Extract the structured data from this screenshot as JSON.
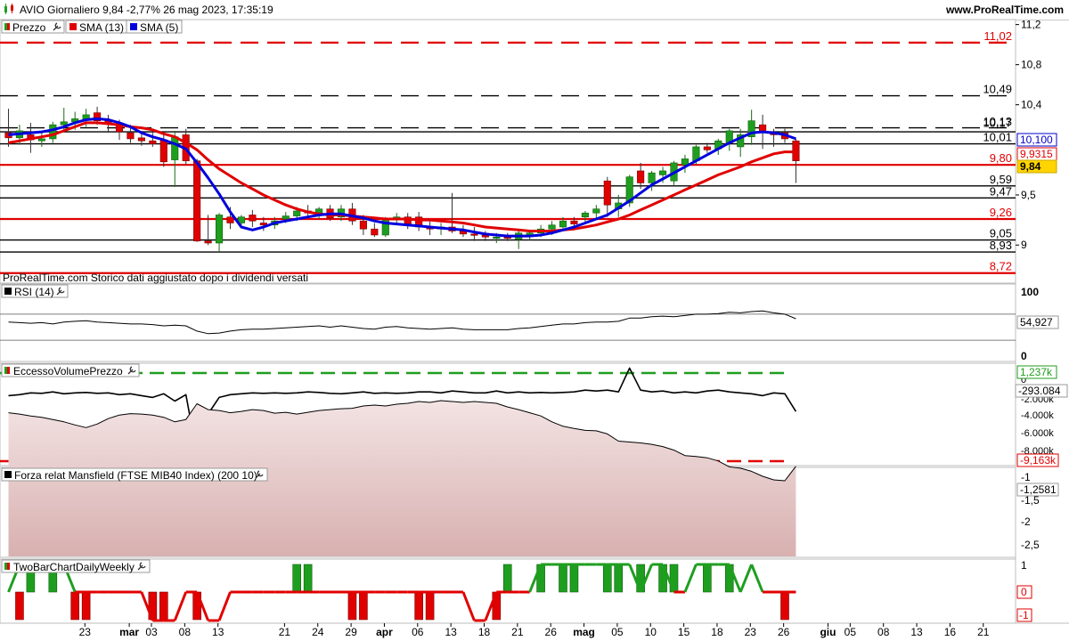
{
  "header": {
    "title": "AVIO Giornaliero 9,84 -2,77% 26 mag 2023, 17:35:19",
    "site": "www.ProRealTime.com"
  },
  "price_panel": {
    "legend": [
      "Prezzo",
      "SMA (13)",
      "SMA (5)"
    ],
    "footnote": "ProRealTime.com  Storico dati aggiustato dopo i dividendi versati",
    "axis_ticks": [
      "11,2",
      "10,8",
      "10,4",
      "9,5",
      "9"
    ],
    "levels": [
      {
        "label": "11,02",
        "value": 11.02,
        "color": "#e00000",
        "style": "dash"
      },
      {
        "label": "10,49",
        "value": 10.49,
        "color": "#000000",
        "style": "dash"
      },
      {
        "label": "10,17",
        "value": 10.17,
        "color": "#000000",
        "style": "dash"
      },
      {
        "label": "10,13",
        "value": 10.13,
        "color": "#000000",
        "style": "solid"
      },
      {
        "label": "10,01",
        "value": 10.01,
        "color": "#000000",
        "style": "solid"
      },
      {
        "label": "9,80",
        "value": 9.8,
        "color": "#e00000",
        "style": "solid"
      },
      {
        "label": "9,59",
        "value": 9.59,
        "color": "#000000",
        "style": "solid"
      },
      {
        "label": "9,47",
        "value": 9.47,
        "color": "#000000",
        "style": "solid"
      },
      {
        "label": "9,26",
        "value": 9.26,
        "color": "#e00000",
        "style": "solid"
      },
      {
        "label": "9,05",
        "value": 9.05,
        "color": "#000000",
        "style": "solid"
      },
      {
        "label": "8,93",
        "value": 8.93,
        "color": "#000000",
        "style": "solid"
      },
      {
        "label": "8,72",
        "value": 8.72,
        "color": "#e00000",
        "style": "solid"
      }
    ],
    "badges": [
      {
        "label": "10,100",
        "value": 10.1,
        "color": "#0000cc",
        "bg": "#ffffff"
      },
      {
        "label": "9,9315",
        "value": 9.9315,
        "color": "#e00000",
        "bg": "#ffffff"
      },
      {
        "label": "9,84",
        "value": 9.84,
        "color": "#000000",
        "bg": "#ffd400"
      }
    ]
  },
  "rsi_panel": {
    "legend": "RSI (14)",
    "axis_ticks": [
      "100",
      "0"
    ],
    "badge": "54,927"
  },
  "volume_panel": {
    "legend": "EccessoVolumePrezzo",
    "axis_ticks": [
      "0",
      "-2.000k",
      "-4.000k",
      "-6.000k",
      "-8.000k"
    ],
    "badges": [
      "1,237k",
      "-293.084",
      "-9,163k"
    ]
  },
  "mansfield_panel": {
    "legend": "Forza relat Mansfield (FTSE MIB40 Index) (200 10)",
    "axis_ticks": [
      "-1",
      "-1,5",
      "-2",
      "-2,5"
    ],
    "badge": "-1,2581"
  },
  "twobar_panel": {
    "legend": "TwoBarChartDailyWeekly",
    "axis_ticks": [
      "1",
      "0",
      "-1"
    ]
  },
  "x_axis": {
    "ticks": [
      {
        "i": 4,
        "label": "23"
      },
      {
        "i": 8,
        "label": "mar",
        "bold": true
      },
      {
        "i": 10,
        "label": "03"
      },
      {
        "i": 13,
        "label": "08"
      },
      {
        "i": 16,
        "label": "13"
      },
      {
        "i": 22,
        "label": "21"
      },
      {
        "i": 25,
        "label": "24"
      },
      {
        "i": 28,
        "label": "29"
      },
      {
        "i": 31,
        "label": "apr",
        "bold": true
      },
      {
        "i": 34,
        "label": "06"
      },
      {
        "i": 37,
        "label": "13"
      },
      {
        "i": 40,
        "label": "18"
      },
      {
        "i": 43,
        "label": "21"
      },
      {
        "i": 46,
        "label": "26"
      },
      {
        "i": 49,
        "label": "mag",
        "bold": true
      },
      {
        "i": 52,
        "label": "05"
      },
      {
        "i": 55,
        "label": "10"
      },
      {
        "i": 58,
        "label": "15"
      },
      {
        "i": 61,
        "label": "18"
      },
      {
        "i": 64,
        "label": "23"
      },
      {
        "i": 67,
        "label": "26"
      },
      {
        "i": 71,
        "label": "giu",
        "bold": true
      },
      {
        "i": 73,
        "label": "05"
      },
      {
        "i": 76,
        "label": "08"
      },
      {
        "i": 79,
        "label": "13"
      },
      {
        "i": 82,
        "label": "16"
      },
      {
        "i": 85,
        "label": "21"
      }
    ]
  },
  "colors": {
    "up": "#1e9e1e",
    "down": "#e00000",
    "sma13": "#e00000",
    "sma5": "#0000dd",
    "mansfield_fill": "#d8b0b0"
  },
  "chart_data": {
    "type": "candlestick",
    "ylim": [
      8.62,
      11.25
    ],
    "candles": [
      {
        "o": 10.12,
        "h": 10.36,
        "l": 9.98,
        "c": 10.07
      },
      {
        "o": 10.07,
        "h": 10.2,
        "l": 10.0,
        "c": 10.14
      },
      {
        "o": 10.1,
        "h": 10.22,
        "l": 9.92,
        "c": 10.05
      },
      {
        "o": 10.04,
        "h": 10.13,
        "l": 9.98,
        "c": 10.06
      },
      {
        "o": 10.06,
        "h": 10.23,
        "l": 10.02,
        "c": 10.2
      },
      {
        "o": 10.2,
        "h": 10.37,
        "l": 10.13,
        "c": 10.23
      },
      {
        "o": 10.23,
        "h": 10.33,
        "l": 10.15,
        "c": 10.26
      },
      {
        "o": 10.25,
        "h": 10.36,
        "l": 10.18,
        "c": 10.3
      },
      {
        "o": 10.32,
        "h": 10.38,
        "l": 10.2,
        "c": 10.24
      },
      {
        "o": 10.24,
        "h": 10.3,
        "l": 10.12,
        "c": 10.21
      },
      {
        "o": 10.2,
        "h": 10.25,
        "l": 10.05,
        "c": 10.13
      },
      {
        "o": 10.12,
        "h": 10.2,
        "l": 10.02,
        "c": 10.06
      },
      {
        "o": 10.07,
        "h": 10.14,
        "l": 9.99,
        "c": 10.04
      },
      {
        "o": 10.04,
        "h": 10.12,
        "l": 9.98,
        "c": 10.01
      },
      {
        "o": 10.05,
        "h": 10.1,
        "l": 9.78,
        "c": 9.83
      },
      {
        "o": 9.85,
        "h": 10.14,
        "l": 9.58,
        "c": 10.08
      },
      {
        "o": 10.1,
        "h": 10.16,
        "l": 9.8,
        "c": 9.84
      },
      {
        "o": 9.84,
        "h": 9.86,
        "l": 9.03,
        "c": 9.04
      },
      {
        "o": 9.04,
        "h": 9.3,
        "l": 9.0,
        "c": 9.02
      },
      {
        "o": 9.02,
        "h": 9.32,
        "l": 8.93,
        "c": 9.3
      },
      {
        "o": 9.28,
        "h": 9.38,
        "l": 9.16,
        "c": 9.22
      },
      {
        "o": 9.22,
        "h": 9.3,
        "l": 9.18,
        "c": 9.28
      },
      {
        "o": 9.3,
        "h": 9.35,
        "l": 9.18,
        "c": 9.24
      },
      {
        "o": 9.22,
        "h": 9.28,
        "l": 9.14,
        "c": 9.2
      },
      {
        "o": 9.2,
        "h": 9.28,
        "l": 9.16,
        "c": 9.24
      },
      {
        "o": 9.26,
        "h": 9.33,
        "l": 9.22,
        "c": 9.29
      },
      {
        "o": 9.29,
        "h": 9.38,
        "l": 9.24,
        "c": 9.34
      },
      {
        "o": 9.34,
        "h": 9.4,
        "l": 9.28,
        "c": 9.32
      },
      {
        "o": 9.32,
        "h": 9.38,
        "l": 9.26,
        "c": 9.36
      },
      {
        "o": 9.36,
        "h": 9.4,
        "l": 9.24,
        "c": 9.27
      },
      {
        "o": 9.28,
        "h": 9.4,
        "l": 9.24,
        "c": 9.36
      },
      {
        "o": 9.36,
        "h": 9.42,
        "l": 9.2,
        "c": 9.24
      },
      {
        "o": 9.24,
        "h": 9.3,
        "l": 9.1,
        "c": 9.16
      },
      {
        "o": 9.16,
        "h": 9.22,
        "l": 9.08,
        "c": 9.1
      },
      {
        "o": 9.1,
        "h": 9.28,
        "l": 9.08,
        "c": 9.26
      },
      {
        "o": 9.26,
        "h": 9.32,
        "l": 9.2,
        "c": 9.28
      },
      {
        "o": 9.28,
        "h": 9.32,
        "l": 9.16,
        "c": 9.2
      },
      {
        "o": 9.28,
        "h": 9.33,
        "l": 9.14,
        "c": 9.18
      },
      {
        "o": 9.18,
        "h": 9.24,
        "l": 9.1,
        "c": 9.16
      },
      {
        "o": 9.16,
        "h": 9.22,
        "l": 9.1,
        "c": 9.18
      },
      {
        "o": 9.18,
        "h": 9.52,
        "l": 9.12,
        "c": 9.14
      },
      {
        "o": 9.14,
        "h": 9.2,
        "l": 9.08,
        "c": 9.11
      },
      {
        "o": 9.11,
        "h": 9.18,
        "l": 9.04,
        "c": 9.1
      },
      {
        "o": 9.1,
        "h": 9.14,
        "l": 9.04,
        "c": 9.08
      },
      {
        "o": 9.07,
        "h": 9.12,
        "l": 9.02,
        "c": 9.08
      },
      {
        "o": 9.08,
        "h": 9.12,
        "l": 9.04,
        "c": 9.07
      },
      {
        "o": 9.06,
        "h": 9.14,
        "l": 8.96,
        "c": 9.12
      },
      {
        "o": 9.1,
        "h": 9.14,
        "l": 9.05,
        "c": 9.12
      },
      {
        "o": 9.12,
        "h": 9.2,
        "l": 9.08,
        "c": 9.16
      },
      {
        "o": 9.16,
        "h": 9.24,
        "l": 9.1,
        "c": 9.2
      },
      {
        "o": 9.18,
        "h": 9.28,
        "l": 9.14,
        "c": 9.24
      },
      {
        "o": 9.24,
        "h": 9.28,
        "l": 9.18,
        "c": 9.21
      },
      {
        "o": 9.28,
        "h": 9.34,
        "l": 9.22,
        "c": 9.32
      },
      {
        "o": 9.32,
        "h": 9.4,
        "l": 9.26,
        "c": 9.36
      },
      {
        "o": 9.64,
        "h": 9.68,
        "l": 9.28,
        "c": 9.4
      },
      {
        "o": 9.36,
        "h": 9.5,
        "l": 9.28,
        "c": 9.42
      },
      {
        "o": 9.42,
        "h": 9.7,
        "l": 9.38,
        "c": 9.68
      },
      {
        "o": 9.74,
        "h": 9.82,
        "l": 9.56,
        "c": 9.62
      },
      {
        "o": 9.62,
        "h": 9.74,
        "l": 9.54,
        "c": 9.72
      },
      {
        "o": 9.7,
        "h": 9.78,
        "l": 9.62,
        "c": 9.74
      },
      {
        "o": 9.64,
        "h": 9.84,
        "l": 9.6,
        "c": 9.82
      },
      {
        "o": 9.8,
        "h": 9.9,
        "l": 9.72,
        "c": 9.86
      },
      {
        "o": 9.84,
        "h": 10.0,
        "l": 9.8,
        "c": 9.98
      },
      {
        "o": 9.98,
        "h": 10.02,
        "l": 9.92,
        "c": 9.95
      },
      {
        "o": 9.96,
        "h": 10.06,
        "l": 9.9,
        "c": 10.04
      },
      {
        "o": 10.02,
        "h": 10.16,
        "l": 9.94,
        "c": 10.14
      },
      {
        "o": 9.98,
        "h": 10.16,
        "l": 9.88,
        "c": 10.1
      },
      {
        "o": 10.08,
        "h": 10.35,
        "l": 10.0,
        "c": 10.24
      },
      {
        "o": 10.2,
        "h": 10.3,
        "l": 9.96,
        "c": 10.12
      },
      {
        "o": 10.12,
        "h": 10.16,
        "l": 9.98,
        "c": 10.1
      },
      {
        "o": 10.12,
        "h": 10.16,
        "l": 10.02,
        "c": 10.06
      },
      {
        "o": 10.04,
        "h": 10.06,
        "l": 9.62,
        "c": 9.84
      }
    ],
    "sma13": [
      10.02,
      10.04,
      10.06,
      10.08,
      10.1,
      10.14,
      10.18,
      10.22,
      10.22,
      10.21,
      10.2,
      10.18,
      10.17,
      10.15,
      10.11,
      10.08,
      10.02,
      9.95,
      9.85,
      9.76,
      9.69,
      9.62,
      9.56,
      9.5,
      9.45,
      9.4,
      9.36,
      9.33,
      9.31,
      9.3,
      9.3,
      9.29,
      9.28,
      9.27,
      9.26,
      9.26,
      9.26,
      9.25,
      9.25,
      9.24,
      9.23,
      9.22,
      9.2,
      9.18,
      9.17,
      9.16,
      9.15,
      9.14,
      9.14,
      9.14,
      9.15,
      9.16,
      9.18,
      9.2,
      9.23,
      9.26,
      9.3,
      9.35,
      9.4,
      9.45,
      9.5,
      9.55,
      9.6,
      9.65,
      9.7,
      9.74,
      9.78,
      9.83,
      9.87,
      9.91,
      9.93,
      9.93
    ],
    "sma5": [
      10.1,
      10.11,
      10.12,
      10.13,
      10.15,
      10.18,
      10.22,
      10.25,
      10.26,
      10.25,
      10.22,
      10.18,
      10.12,
      10.08,
      10.05,
      10.01,
      9.96,
      9.82,
      9.67,
      9.51,
      9.33,
      9.18,
      9.15,
      9.18,
      9.22,
      9.24,
      9.26,
      9.28,
      9.3,
      9.31,
      9.31,
      9.29,
      9.27,
      9.24,
      9.22,
      9.21,
      9.2,
      9.19,
      9.18,
      9.17,
      9.16,
      9.15,
      9.13,
      9.11,
      9.1,
      9.09,
      9.09,
      9.09,
      9.1,
      9.12,
      9.15,
      9.18,
      9.22,
      9.26,
      9.3,
      9.37,
      9.44,
      9.52,
      9.6,
      9.66,
      9.72,
      9.78,
      9.84,
      9.9,
      9.96,
      10.02,
      10.07,
      10.12,
      10.13,
      10.12,
      10.1,
      10.06
    ],
    "rsi": [
      58,
      57,
      56,
      57,
      55,
      58,
      59,
      60,
      58,
      57,
      56,
      55,
      55,
      54,
      52,
      53,
      52,
      44,
      40,
      41,
      44,
      46,
      47,
      47,
      48,
      49,
      50,
      51,
      52,
      50,
      52,
      50,
      48,
      47,
      50,
      51,
      49,
      48,
      47,
      48,
      49,
      47,
      46,
      46,
      46,
      46,
      48,
      49,
      51,
      53,
      55,
      55,
      57,
      58,
      58,
      59,
      64,
      64,
      66,
      67,
      66,
      68,
      70,
      70,
      71,
      73,
      72,
      74,
      75,
      72,
      70,
      63
    ],
    "volume": [
      -120,
      -110,
      -90,
      -95,
      -80,
      -100,
      -90,
      -85,
      -95,
      -90,
      -110,
      -100,
      -120,
      -140,
      -100,
      -180,
      -110,
      -760,
      -320,
      -140,
      -110,
      -100,
      -90,
      -95,
      -90,
      -95,
      -90,
      -80,
      -85,
      -95,
      -100,
      -90,
      -80,
      -95,
      -90,
      -95,
      -90,
      -80,
      -80,
      -90,
      -70,
      -80,
      -90,
      -90,
      -70,
      -90,
      -80,
      -90,
      -85,
      -90,
      -85,
      -80,
      -60,
      -70,
      -60,
      -80,
      180,
      -60,
      -80,
      -70,
      -90,
      -80,
      -90,
      -70,
      -60,
      -80,
      -90,
      -100,
      -120,
      -90,
      -100,
      -293
    ],
    "mansfield": [
      -2.45,
      -2.42,
      -2.38,
      -2.35,
      -2.3,
      -2.25,
      -2.18,
      -2.12,
      -2.2,
      -2.32,
      -2.4,
      -2.43,
      -2.42,
      -2.4,
      -2.35,
      -2.25,
      -2.3,
      -2.65,
      -2.52,
      -2.5,
      -2.45,
      -2.48,
      -2.52,
      -2.5,
      -2.44,
      -2.46,
      -2.42,
      -2.46,
      -2.5,
      -2.52,
      -2.54,
      -2.55,
      -2.6,
      -2.62,
      -2.6,
      -2.64,
      -2.66,
      -2.7,
      -2.68,
      -2.72,
      -2.7,
      -2.68,
      -2.7,
      -2.68,
      -2.66,
      -2.58,
      -2.52,
      -2.45,
      -2.38,
      -2.25,
      -2.15,
      -2.1,
      -2.06,
      -2.05,
      -1.98,
      -1.82,
      -1.8,
      -1.78,
      -1.75,
      -1.7,
      -1.62,
      -1.5,
      -1.48,
      -1.45,
      -1.38,
      -1.25,
      -1.22,
      -1.15,
      -1.04,
      -0.96,
      -0.94,
      -1.26
    ],
    "twobar_bars": [
      0,
      -1,
      1,
      0,
      1,
      0,
      -1,
      -1,
      0,
      0,
      0,
      0,
      0,
      -1,
      -1,
      0,
      0,
      -1,
      0,
      0,
      0,
      0,
      0,
      0,
      0,
      0,
      1,
      1,
      0,
      0,
      0,
      -1,
      -1,
      0,
      0,
      0,
      0,
      -1,
      -1,
      0,
      0,
      0,
      0,
      0,
      -1,
      1,
      0,
      0,
      1,
      0,
      1,
      1,
      0,
      0,
      1,
      1,
      0,
      1,
      0,
      1,
      1,
      0,
      0,
      1,
      0,
      1,
      0,
      0,
      0,
      0,
      -1,
      0
    ],
    "twobar_line": [
      0,
      1,
      1,
      1,
      1,
      1,
      0,
      0,
      0,
      0,
      0,
      0,
      0,
      -1,
      -1,
      -1,
      0,
      0,
      -1,
      -1,
      0,
      0,
      0,
      0,
      0,
      0,
      0,
      0,
      0,
      0,
      0,
      0,
      0,
      0,
      0,
      0,
      0,
      0,
      0,
      0,
      0,
      0,
      -1,
      -1,
      0,
      0,
      0,
      0,
      1,
      1,
      1,
      1,
      1,
      1,
      1,
      1,
      1,
      0,
      1,
      1,
      0,
      0,
      1,
      1,
      1,
      1,
      0,
      1,
      0,
      0,
      0,
      0
    ]
  }
}
